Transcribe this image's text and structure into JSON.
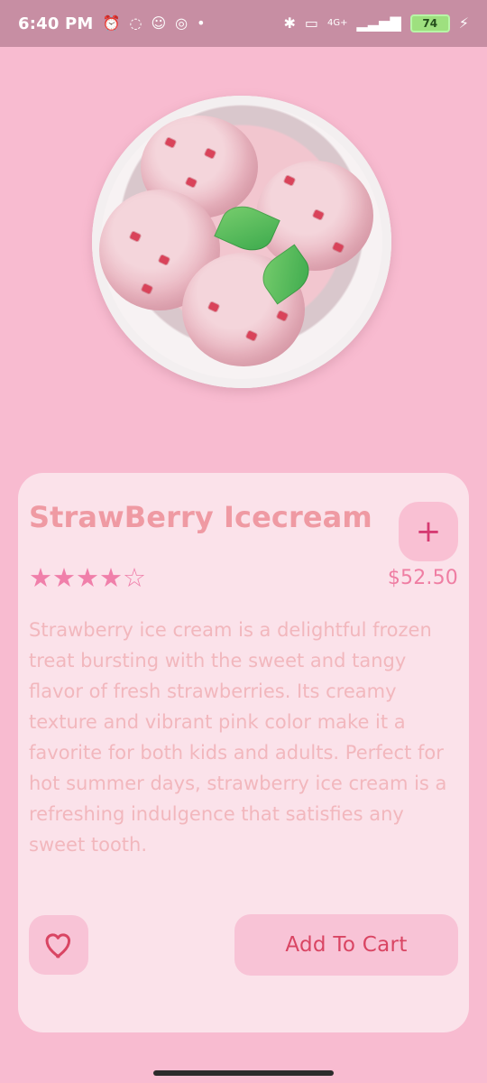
{
  "status_bar": {
    "time": "6:40 PM",
    "left_icons": [
      "alarm-off-icon",
      "whatsapp-icon",
      "snapchat-icon",
      "instagram-icon",
      "dot-icon"
    ],
    "right_icons": [
      "bluetooth-icon",
      "volte-icon",
      "4g-icon",
      "signal-icon",
      "battery-icon",
      "charging-icon"
    ],
    "network": "4G+",
    "battery": "74"
  },
  "product": {
    "title": "StrawBerry Icecream",
    "plus_label": "+",
    "rating_display": "★★★★☆",
    "rating_value": 4,
    "rating_max": 5,
    "price": "$52.50",
    "description": "Strawberry ice cream is a delightful frozen treat bursting with the sweet and tangy flavor of fresh strawberries. Its creamy texture and vibrant pink color make it a favorite for both kids and adults. Perfect for hot summer days, strawberry ice cream is a refreshing indulgence that satisfies any sweet tooth."
  },
  "actions": {
    "favorite_icon": "heart-icon",
    "add_to_cart_label": "Add To Cart"
  },
  "colors": {
    "background": "#f8bbd0",
    "card": "#fbe2ea",
    "accent": "#d94563",
    "title": "#ef9aa3"
  }
}
